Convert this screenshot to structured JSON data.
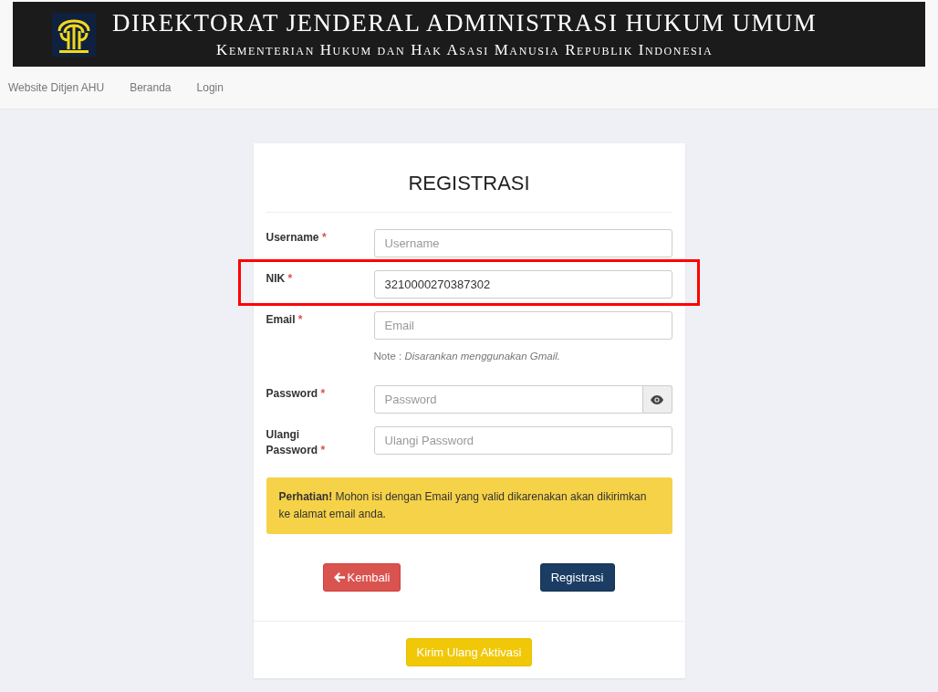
{
  "banner": {
    "title": "DIREKTORAT JENDERAL ADMINISTRASI HUKUM UMUM",
    "subtitle": "Kementerian Hukum dan Hak Asasi Manusia Republik Indonesia"
  },
  "nav": [
    "Website Ditjen AHU",
    "Beranda",
    "Login"
  ],
  "form": {
    "title": "REGISTRASI",
    "fields": [
      {
        "kind": "text",
        "label": "Username",
        "required_mark": "*",
        "placeholder": "Username",
        "highlighted": false
      },
      {
        "kind": "text",
        "label": "NIK",
        "required_mark": "*",
        "value": "3210000270387302",
        "highlighted": true
      },
      {
        "kind": "text",
        "label": "Email",
        "required_mark": "*",
        "placeholder": "Email",
        "note_label": "Note :",
        "note": "Disarankan menggunakan Gmail.",
        "highlighted": false
      },
      {
        "kind": "password",
        "label": "Password",
        "required_mark": "*",
        "placeholder": "Password",
        "highlighted": false
      },
      {
        "kind": "text",
        "label": "Ulangi Password",
        "required_mark": "*",
        "placeholder": "Ulangi Password",
        "highlighted": false
      }
    ],
    "alert": "**Perhatian!** Mohon isi dengan Email yang valid dikarenakan akan dikirimkan ke alamat email anda.",
    "back_button": "Kembali",
    "submit_button": "Registrasi",
    "resend_button": "Kirim Ulang Aktivasi"
  }
}
